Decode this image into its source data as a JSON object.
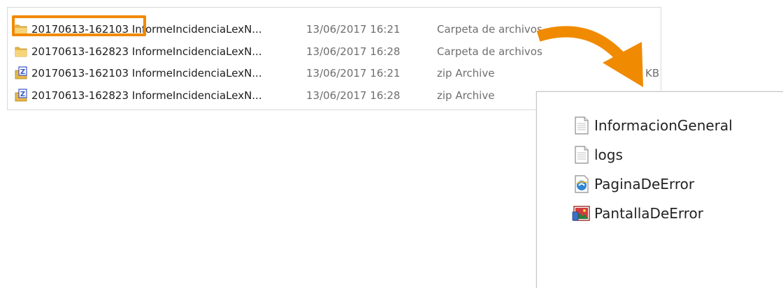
{
  "explorer": {
    "rows": [
      {
        "icon": "folder-icon",
        "name": "20170613-162103 InformeIncidenciaLexN...",
        "date": "13/06/2017 16:21",
        "type": "Carpeta de archivos",
        "size": ""
      },
      {
        "icon": "folder-icon",
        "name": "20170613-162823 InformeIncidenciaLexN...",
        "date": "13/06/2017 16:28",
        "type": "Carpeta de archivos",
        "size": ""
      },
      {
        "icon": "zip-archive-icon",
        "name": "20170613-162103 InformeIncidenciaLexN...",
        "date": "13/06/2017 16:21",
        "type": "zip Archive",
        "size": "KB"
      },
      {
        "icon": "zip-archive-icon",
        "name": "20170613-162823 InformeIncidenciaLexN...",
        "date": "13/06/2017 16:28",
        "type": "zip Archive",
        "size": ""
      }
    ]
  },
  "highlight": {
    "color": "#f08a00"
  },
  "zoom_panel": {
    "items": [
      {
        "icon": "text-file-icon",
        "label": "InformacionGeneral"
      },
      {
        "icon": "text-file-icon",
        "label": "logs"
      },
      {
        "icon": "html-file-icon",
        "label": "PaginaDeError"
      },
      {
        "icon": "image-file-icon",
        "label": "PantallaDeError"
      }
    ]
  },
  "colors": {
    "accent": "#f08a00",
    "folder": "#e8b74a",
    "zip": "#3a56c8"
  }
}
